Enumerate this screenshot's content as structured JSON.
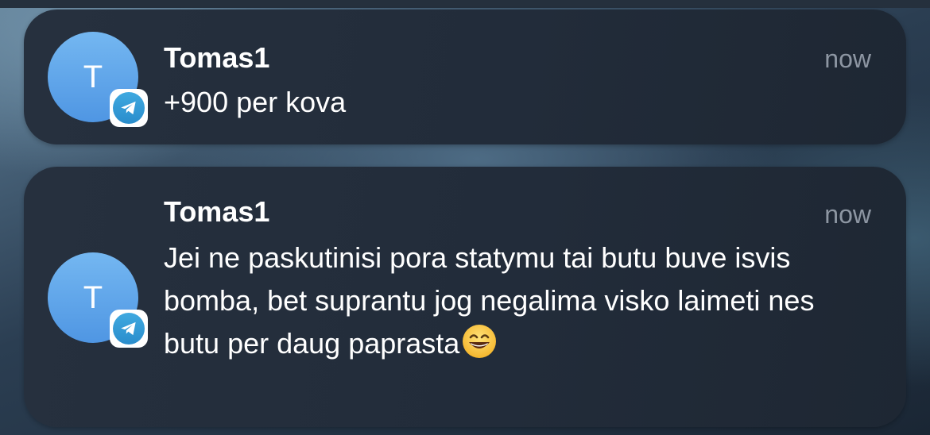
{
  "notifications": [
    {
      "avatar_initial": "T",
      "app_icon": "telegram-icon",
      "sender": "Tomas1",
      "time": "now",
      "message": "+900 per kova"
    },
    {
      "avatar_initial": "T",
      "app_icon": "telegram-icon",
      "sender": "Tomas1",
      "time": "now",
      "message": "Jei ne paskutinisi pora statymu tai butu buve isvis bomba, bet suprantu jog negalima visko laimeti nes butu per daug paprasta",
      "message_emoji": "grinning-face-emoji"
    }
  ],
  "colors": {
    "card_background": "#242e3c",
    "avatar_gradient_top": "#74b7f1",
    "avatar_gradient_bottom": "#4f96e3",
    "telegram_blue": "#2a8dcc",
    "time_text": "#8d96a2"
  }
}
